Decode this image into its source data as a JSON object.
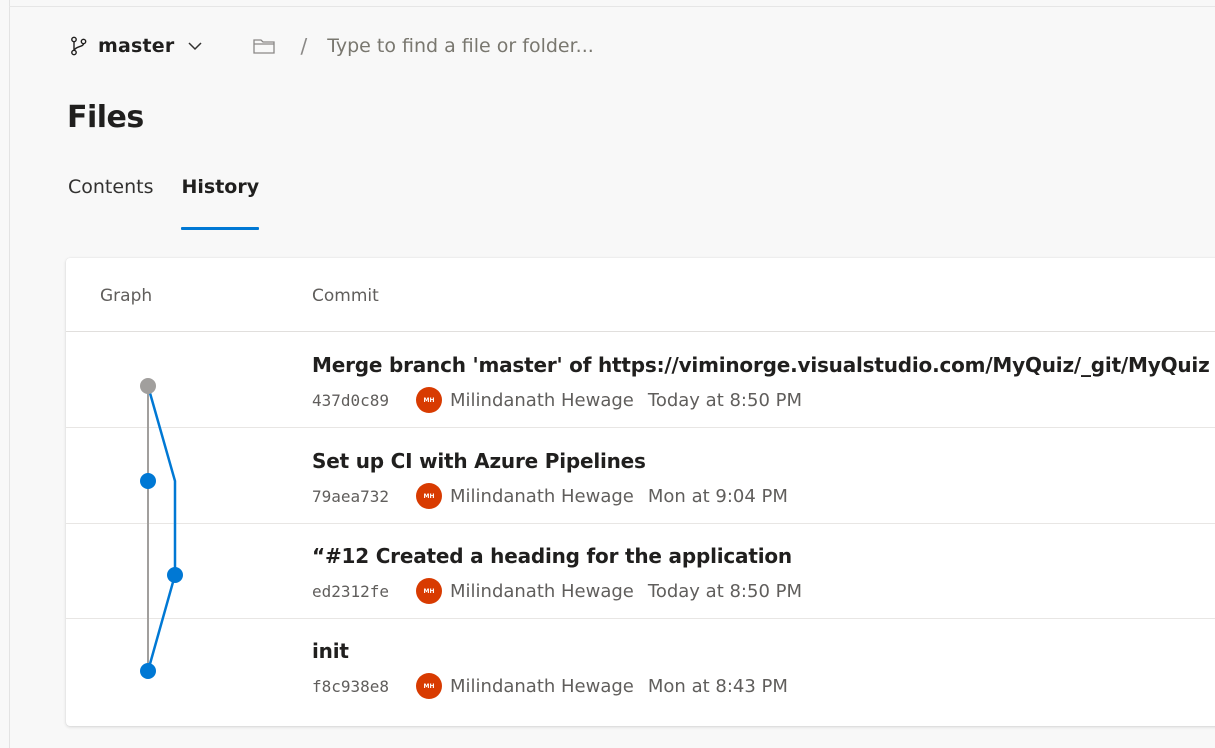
{
  "toolbar": {
    "branch": "master",
    "path_separator": "/",
    "search_placeholder": "Type to find a file or folder..."
  },
  "page": {
    "title": "Files"
  },
  "tabs": [
    {
      "label": "Contents",
      "active": false
    },
    {
      "label": "History",
      "active": true
    }
  ],
  "table": {
    "columns": {
      "graph": "Graph",
      "commit": "Commit"
    },
    "rows": [
      {
        "title": "Merge branch 'master' of https://viminorge.visualstudio.com/MyQuiz/_git/MyQuiz",
        "hash": "437d0c89",
        "avatar": "MH",
        "author": "Milindanath Hewage",
        "time": "Today at 8:50 PM"
      },
      {
        "title": "Set up CI with Azure Pipelines",
        "hash": "79aea732",
        "avatar": "MH",
        "author": "Milindanath Hewage",
        "time": "Mon at 9:04 PM"
      },
      {
        "title": "“#12 Created a heading for the application",
        "hash": "ed2312fe",
        "avatar": "MH",
        "author": "Milindanath Hewage",
        "time": "Today at 8:50 PM"
      },
      {
        "title": "init",
        "hash": "f8c938e8",
        "avatar": "MH",
        "author": "Milindanath Hewage",
        "time": "Mon at 8:43 PM"
      }
    ]
  },
  "colors": {
    "accent": "#0078d4",
    "graph_line": "#0078d4",
    "graph_merge_node": "#a19f9d",
    "avatar_bg": "#d83b01"
  },
  "icons": {
    "branch": "branch-icon",
    "dropdown": "chevron-down-icon",
    "folder": "folder-icon"
  }
}
